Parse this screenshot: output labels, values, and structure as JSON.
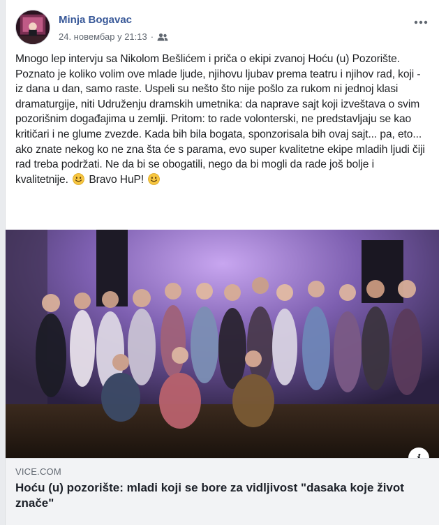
{
  "post": {
    "author": "Minja Bogavac",
    "timestamp": "24. новембар у 21:13",
    "separator": "·",
    "audience_icon": "friends-icon",
    "more_icon": "more-horizontal-icon",
    "text_main": "Mnogo lep intervju sa Nikolom Bešlićem i priča o ekipi zvanoj Hoću (u) Pozorište. Poznato je koliko volim ove mlade ljude, njihovu ljubav prema teatru i njihov rad, koji - iz dana u dan, samo raste. Uspeli su nešto što nije pošlo za rukom ni jednoj klasi dramaturgije, niti Udruženju dramskih umetnika: da naprave sajt koji izveštava o svim pozorišnim događajima u zemlji. Pritom: to rade volonterski, ne predstavljaju se kao kritičari i ne glume zvezde. Kada bih bila bogata, sponzorisala bih ovaj sajt... pa, eto... ako znate nekog ko ne zna šta će s parama, evo super kvalitetne ekipe mladih ljudi čiji rad treba podržati. Ne da bi se obogatili, nego da bi mogli da rade još bolje i kvalitetnije.",
    "text_tail": "Bravo HuP!",
    "emoji_icon": "smiley-emoji-icon"
  },
  "link_preview": {
    "domain": "VICE.COM",
    "title": "Hoću (u) pozorište: mladi koji se bore za vidljivost \"dasaka koje život znače\"",
    "info_label": "i"
  },
  "colors": {
    "author": "#385898",
    "meta": "#606770",
    "text": "#1c1e21",
    "preview_bg": "#f2f3f5",
    "photo_light": "#b592e0"
  }
}
